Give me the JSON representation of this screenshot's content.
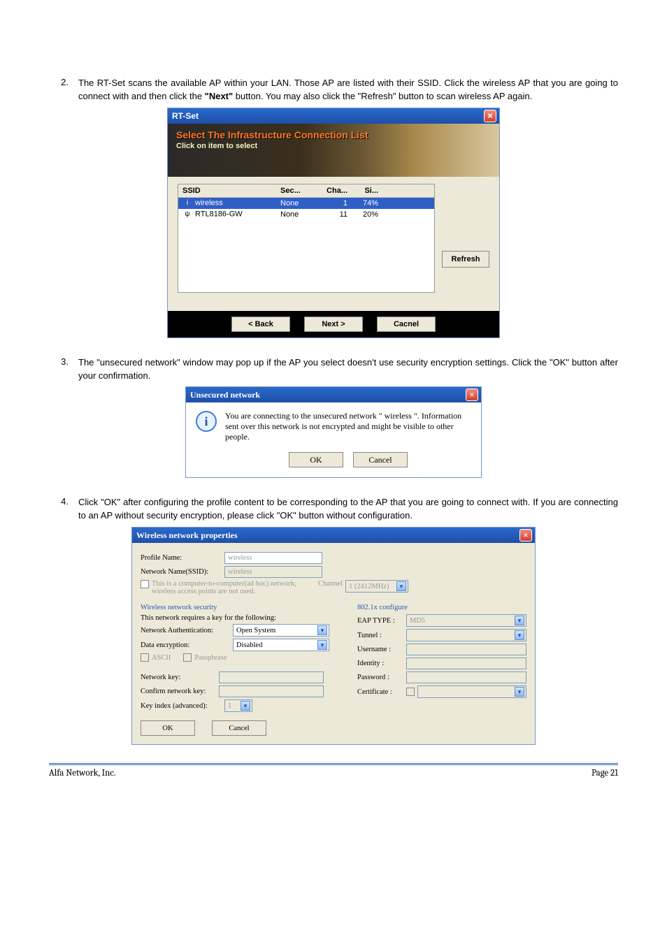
{
  "steps": {
    "s2": {
      "num": "2.",
      "text_a": "The RT-Set scans the available AP within your LAN. Those AP are listed with their SSID. Click the wireless AP that you are going to connect with and then click the ",
      "bold": "\"Next\"",
      "text_b": " button. You may also click the \"Refresh\" button to scan wireless AP again."
    },
    "s3": {
      "num": "3.",
      "text": "The \"unsecured network\" window may pop up if the AP you select doesn't use security encryption settings. Click the \"OK\" button after your confirmation."
    },
    "s4": {
      "num": "4.",
      "text": "Click \"OK\" after configuring the profile content to be corresponding to the AP that you are going to connect with. If you are connecting to an AP without security encryption, please click \"OK\" button without configuration."
    }
  },
  "rtset": {
    "title": "RT-Set",
    "banner_t1": "Select The Infrastructure Connection List",
    "banner_t2": "Click on item to select",
    "headers": {
      "ssid": "SSID",
      "sec": "Sec...",
      "cha": "Cha...",
      "sig": "Si..."
    },
    "rows": [
      {
        "ssid": "wireless",
        "sec": "None",
        "cha": "1",
        "sig": "74%",
        "selected": true,
        "icon": "i"
      },
      {
        "ssid": "RTL8186-GW",
        "sec": "None",
        "cha": "11",
        "sig": "20%",
        "selected": false,
        "icon": "ψ"
      }
    ],
    "refresh": "Refresh",
    "back": "< Back",
    "next": "Next >",
    "cancel": "Cacnel"
  },
  "unsec": {
    "title": "Unsecured network",
    "msg": "You are connecting to the unsecured network \" wireless \". Information sent over this network is not encrypted and might be visible to other people.",
    "ok": "OK",
    "cancel": "Cancel"
  },
  "props": {
    "title": "Wireless network properties",
    "profile_name_lbl": "Profile Name:",
    "profile_name_val": "wireless",
    "ssid_lbl": "Network Name(SSID):",
    "ssid_val": "wireless",
    "adhoc": "This is a computer-to-computer(ad hoc) network; wireless access points are not used.",
    "channel_lbl": "Channel",
    "channel_val": "1 (2412MHz)",
    "sec_header": "Wireless network security",
    "sec_sub": "This network requires a key for the following:",
    "auth_lbl": "Network Authentication:",
    "auth_val": "Open System",
    "enc_lbl": "Data encryption:",
    "enc_val": "Disabled",
    "ascii": "ASCII",
    "pass": "Passphrase",
    "netkey": "Network key:",
    "confkey": "Confirm network key:",
    "keyidx": "Key index (advanced):",
    "keyidx_val": "1",
    "r_header": "802.1x configure",
    "eap_lbl": "EAP TYPE :",
    "eap_val": "MD5",
    "tunnel": "Tunnel :",
    "user": "Username :",
    "ident": "Identity :",
    "passw": "Password :",
    "cert": "Certificate :",
    "ok": "OK",
    "cancel": "Cancel"
  },
  "footer": {
    "left": "Alfa Network, Inc.",
    "right": "Page 21"
  }
}
